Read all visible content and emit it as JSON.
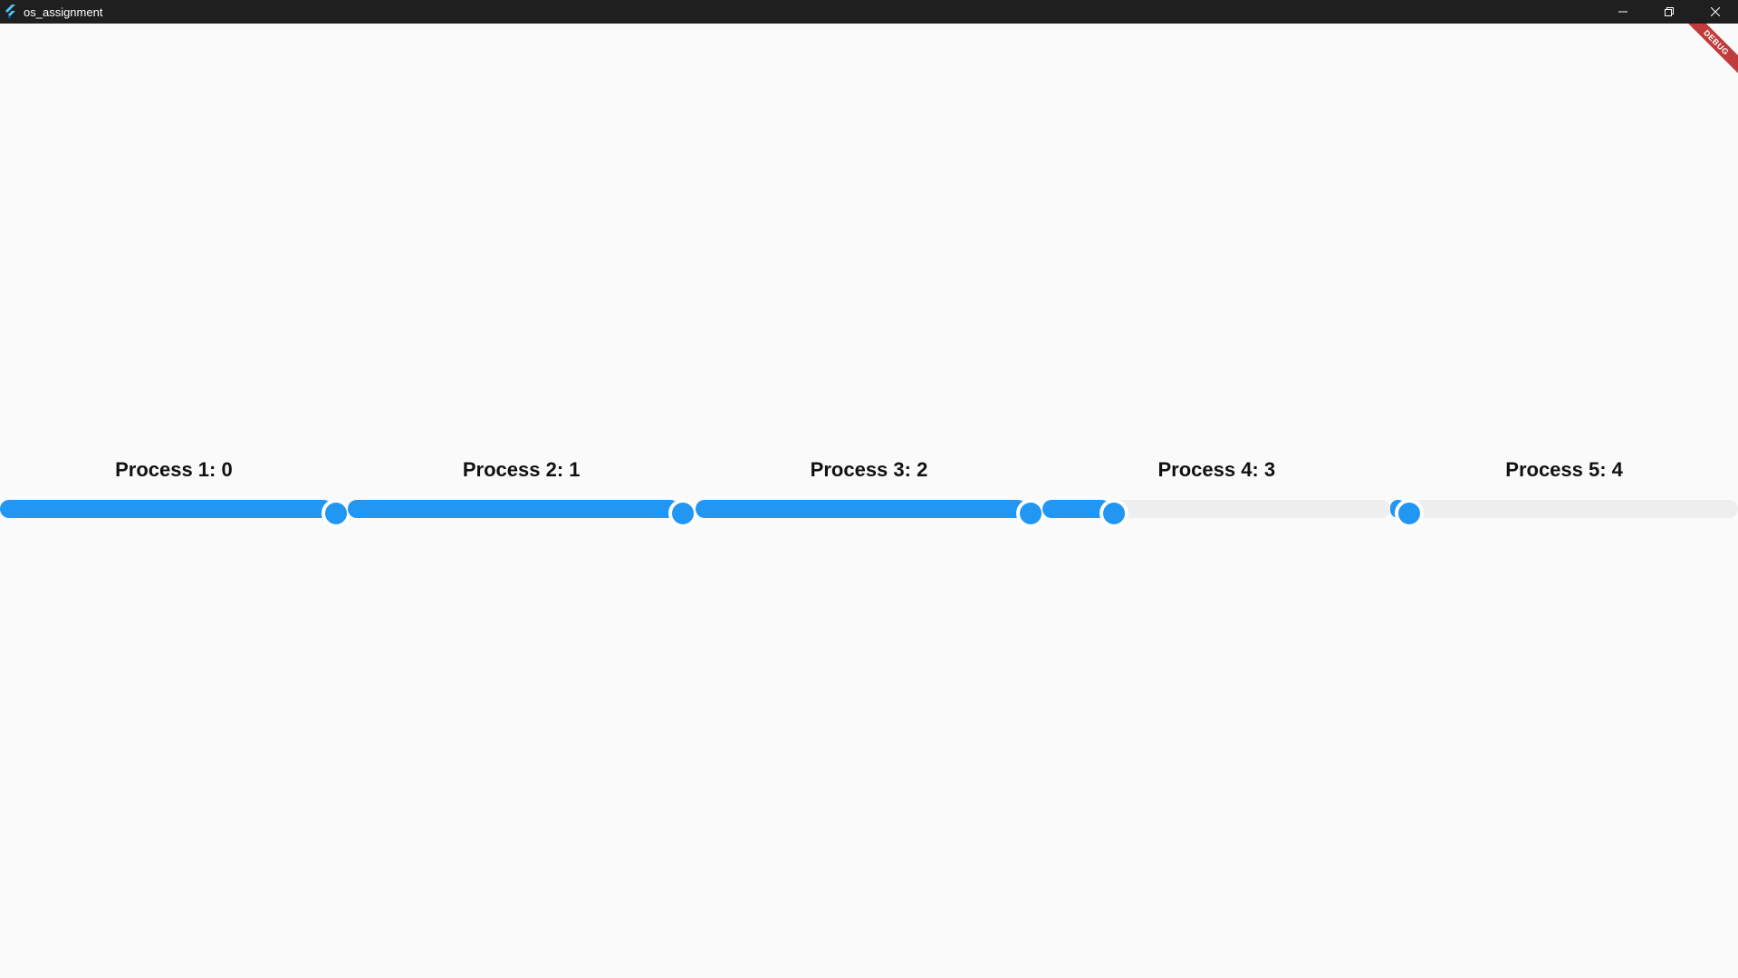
{
  "window": {
    "title": "os_assignment",
    "controls": {
      "minimize_icon": "minimize-icon",
      "maximize_icon": "restore-icon",
      "close_icon": "close-icon"
    }
  },
  "debug_banner": "DEBUG",
  "colors": {
    "accent": "#2196f3",
    "track_inactive": "#eeeeee",
    "titlebar": "#1f1f1f",
    "debug": "#b71c1c"
  },
  "processes": [
    {
      "label": "Process 1: 0",
      "fraction": 0.955
    },
    {
      "label": "Process 2: 1",
      "fraction": 0.955
    },
    {
      "label": "Process 3: 2",
      "fraction": 0.955
    },
    {
      "label": "Process 4: 3",
      "fraction": 0.195
    },
    {
      "label": "Process 5: 4",
      "fraction": 0.045
    }
  ]
}
